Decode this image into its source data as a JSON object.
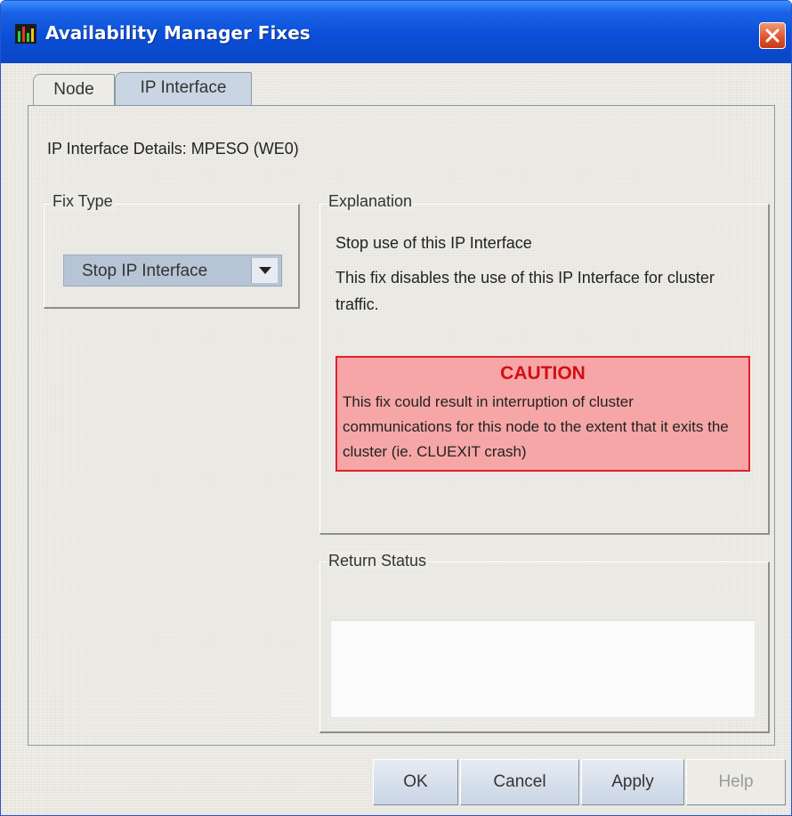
{
  "window": {
    "title": "Availability Manager Fixes",
    "close_icon": "close-icon"
  },
  "tabs": [
    {
      "label": "Node",
      "selected": false
    },
    {
      "label": "IP Interface",
      "selected": true
    }
  ],
  "details": {
    "label": "IP Interface Details: MPESO  (WE0)"
  },
  "fix_type": {
    "group_title": "Fix Type",
    "selected_value": "Stop IP Interface"
  },
  "explanation": {
    "group_title": "Explanation",
    "heading": "Stop use of this IP Interface",
    "body": "This fix disables the use of this IP Interface for cluster traffic.",
    "caution": {
      "title": "CAUTION",
      "text": "This fix could result in interruption of cluster communications for this node to the extent that it exits the cluster (ie. CLUEXIT crash)"
    }
  },
  "return_status": {
    "group_title": "Return Status",
    "value": ""
  },
  "buttons": {
    "ok": "OK",
    "cancel": "Cancel",
    "apply": "Apply",
    "help": "Help"
  },
  "colors": {
    "titlebar": "#0b4fd8",
    "caution_bg": "#f6a6a6",
    "caution_text": "#d20f14",
    "selected_tab": "#cad5e3"
  }
}
